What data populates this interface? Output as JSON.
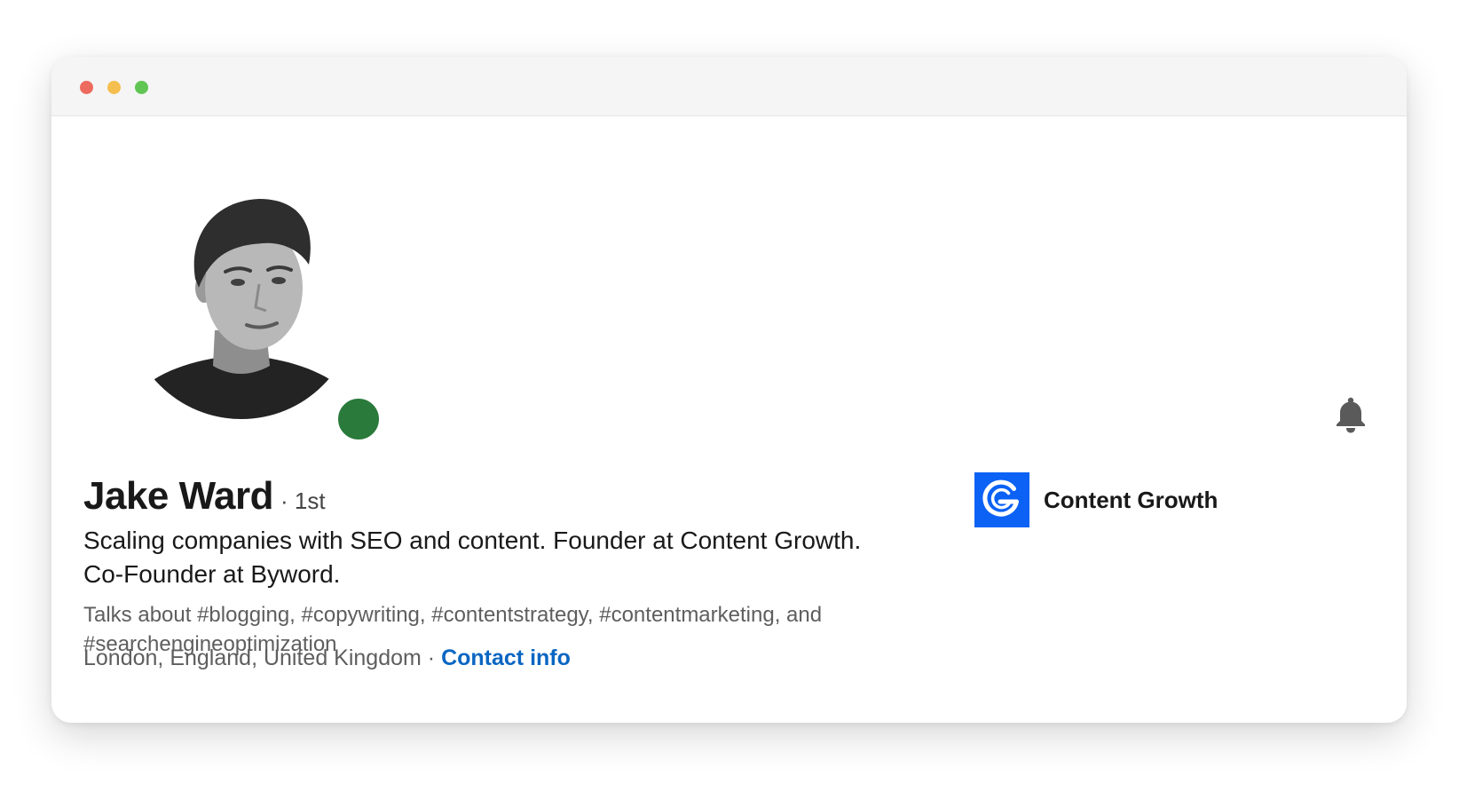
{
  "window": {
    "traffic_lights": {
      "close": "#ed6a5e",
      "minimize": "#f5bf4f",
      "zoom": "#61c554"
    }
  },
  "profile": {
    "name": "Jake Ward",
    "degree": "· 1st",
    "headline": "Scaling companies with SEO and content. Founder at Content Growth. Co-Founder at Byword.",
    "talks_about": "Talks about #blogging, #copywriting, #contentstrategy, #contentmarketing, and #searchengineoptimization",
    "location": "London, England, United Kingdom",
    "separator": "·",
    "contact_info": "Contact info",
    "presence_status": "online",
    "presence_color": "#2a7a3b",
    "avatar_icon": "profile-photo"
  },
  "company": {
    "name": "Content Growth",
    "logo_icon": "content-growth-logo",
    "logo_color": "#0b62f5"
  },
  "actions": {
    "notification_icon": "bell-icon"
  },
  "colors": {
    "link": "#0a66c2",
    "text": "#191919",
    "secondary_text": "#5e5e5e"
  }
}
